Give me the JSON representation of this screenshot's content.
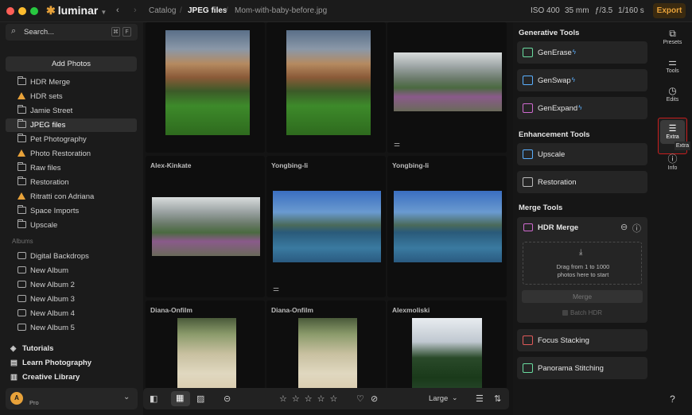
{
  "app": {
    "name": "luminar"
  },
  "breadcrumb": {
    "root": "Catalog",
    "folder": "JPEG files",
    "file": "Mom-with-baby-before.jpg"
  },
  "exif": {
    "iso": "ISO 400",
    "focal": "35 mm",
    "aperture": "ƒ/3.5",
    "shutter": "1/160 s"
  },
  "toolbar": {
    "export_label": "Export"
  },
  "search": {
    "placeholder": "Search...",
    "shortcut_1": "⌘",
    "shortcut_2": "F"
  },
  "sidebar": {
    "add_photos_label": "Add Photos",
    "folders": [
      {
        "label": "HDR Merge",
        "icon": "folder-icon"
      },
      {
        "label": "HDR sets",
        "icon": "warning-icon"
      },
      {
        "label": "Jamie Street",
        "icon": "folder-icon"
      },
      {
        "label": "JPEG files",
        "icon": "folder-icon",
        "selected": true
      },
      {
        "label": "Pet Photography",
        "icon": "folder-icon"
      },
      {
        "label": "Photo Restoration",
        "icon": "warning-icon"
      },
      {
        "label": "Raw files",
        "icon": "folder-icon"
      },
      {
        "label": "Restoration",
        "icon": "folder-icon"
      },
      {
        "label": "Ritratti con Adriana",
        "icon": "warning-icon"
      },
      {
        "label": "Space Imports",
        "icon": "folder-icon"
      },
      {
        "label": "Upscale",
        "icon": "folder-icon"
      }
    ],
    "albums_heading": "Albums",
    "albums": [
      {
        "label": "Digital Backdrops"
      },
      {
        "label": "New Album"
      },
      {
        "label": "New Album 2"
      },
      {
        "label": "New Album 3"
      },
      {
        "label": "New Album 4"
      },
      {
        "label": "New Album 5"
      }
    ],
    "links": [
      {
        "label": "Tutorials",
        "icon": "graduation-cap-icon"
      },
      {
        "label": "Learn Photography",
        "icon": "book-icon"
      },
      {
        "label": "Creative Library",
        "icon": "library-icon"
      }
    ],
    "profile": {
      "avatar_letter": "A",
      "plan": "Pro"
    }
  },
  "grid": {
    "cells": [
      {
        "title": "",
        "image": "mountain-sunset"
      },
      {
        "title": "",
        "image": "mountain-sunset"
      },
      {
        "title": "",
        "image": "mountain-path",
        "adjusted": true
      },
      {
        "title": "Alex-Kinkate",
        "image": "mountain-path"
      },
      {
        "title": "Yongbing-li",
        "image": "lake",
        "adjusted": true
      },
      {
        "title": "Yongbing-li",
        "image": "lake"
      },
      {
        "title": "Diana-Onfilm",
        "image": "baby-leaves"
      },
      {
        "title": "Diana-Onfilm",
        "image": "baby-leaves"
      },
      {
        "title": "Alexmoliski",
        "image": "forest-mountain"
      }
    ]
  },
  "bottombar": {
    "size_label": "Large"
  },
  "tools": {
    "generative_heading": "Generative Tools",
    "generative": [
      {
        "label": "GenErase",
        "icon": "eraser-icon"
      },
      {
        "label": "GenSwap",
        "icon": "swap-icon"
      },
      {
        "label": "GenExpand",
        "icon": "expand-icon"
      }
    ],
    "enhancement_heading": "Enhancement Tools",
    "enhancement": [
      {
        "label": "Upscale",
        "icon": "upscale-icon"
      },
      {
        "label": "Restoration",
        "icon": "image-restore-icon"
      }
    ],
    "merge_heading": "Merge Tools",
    "hdr": {
      "title": "HDR Merge",
      "drop_line1": "Drag from 1 to 1000",
      "drop_line2": "photos here to start",
      "merge_label": "Merge",
      "batch_label": "Batch HDR"
    },
    "more": [
      {
        "label": "Focus Stacking",
        "icon": "focus-stack-icon"
      },
      {
        "label": "Panorama Stitching",
        "icon": "panorama-icon"
      }
    ]
  },
  "iconbar": {
    "items": [
      {
        "label": "Presets"
      },
      {
        "label": "Tools"
      },
      {
        "label": "Edits"
      },
      {
        "label": "Extra",
        "selected": true,
        "tooltip": "Extra"
      },
      {
        "label": "Info"
      }
    ]
  },
  "colors": {
    "accent": "#e8a23a",
    "highlight": "#c81e1e",
    "spark": "#5ab0ff"
  }
}
